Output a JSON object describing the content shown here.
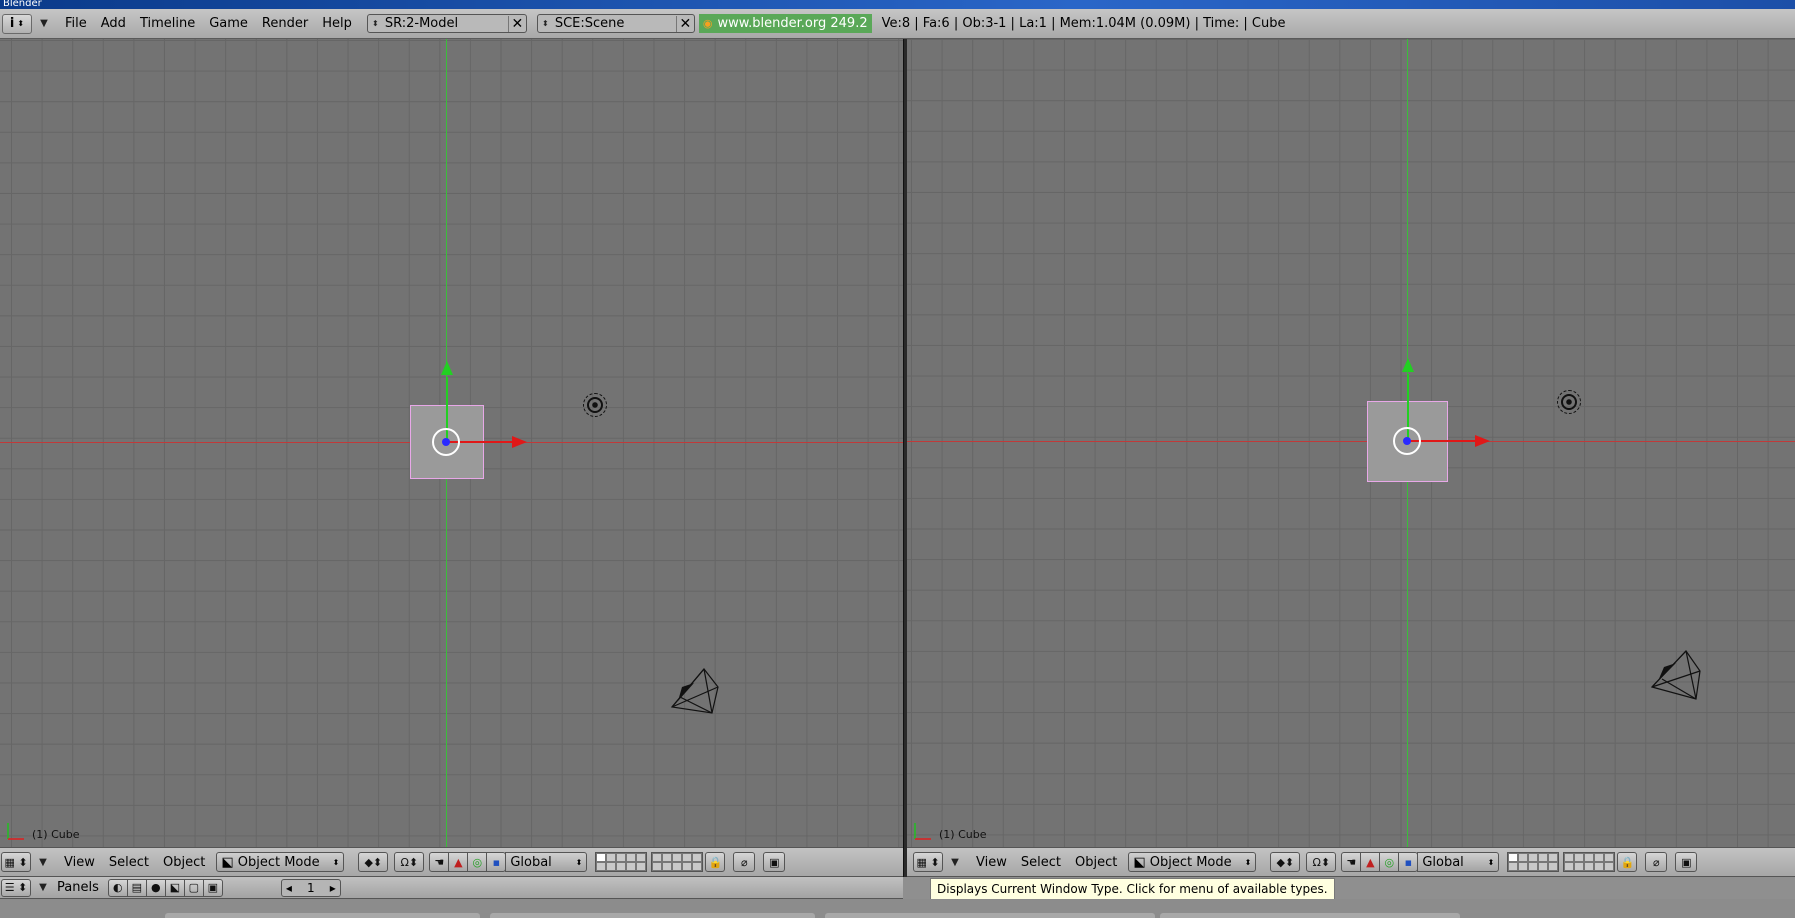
{
  "window_title": "Blender",
  "info_header": {
    "window_type_icon": "i",
    "menus": [
      "File",
      "Add",
      "Timeline",
      "Game",
      "Render",
      "Help"
    ],
    "screen": "SR:2-Model",
    "scene": "SCE:Scene",
    "website": "www.blender.org 249.2",
    "stats": "Ve:8 | Fa:6 | Ob:3-1 | La:1  | Mem:1.04M (0.09M)  | Time: | Cube"
  },
  "viewports": [
    {
      "label": "(1) Cube"
    },
    {
      "label": "(1) Cube"
    }
  ],
  "view_header": {
    "menus": [
      "View",
      "Select",
      "Object"
    ],
    "mode": "Object Mode",
    "orientation": "Global",
    "icons": [
      "window-type-icon",
      "collapse-icon",
      "draw-type-icon",
      "pivot-icon",
      "hand-icon",
      "rotate-icon",
      "scale-icon",
      "layers-icon",
      "lock-icon",
      "render-icon"
    ]
  },
  "buttons_header": {
    "label": "Panels",
    "frame": "1"
  },
  "tooltip": "Displays Current Window Type. Click for menu of available types.",
  "colors": {
    "viewport_bg": "#737373",
    "grid": "#666666",
    "x_axis": "#c03a3a",
    "y_axis": "#3bbd3b",
    "cube_outline": "#e8a8e8",
    "website_bg": "#5aa858"
  }
}
